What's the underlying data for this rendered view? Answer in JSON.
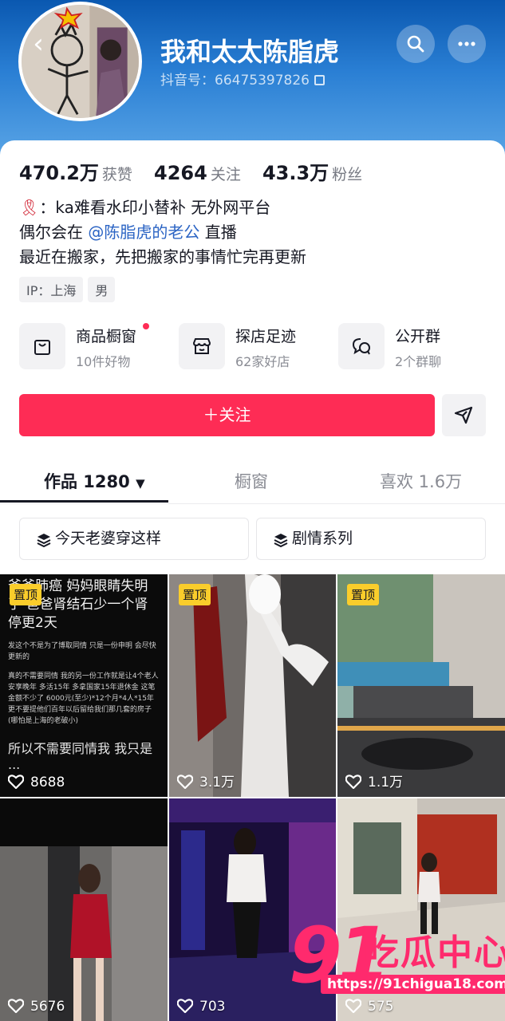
{
  "profile": {
    "nickname": "我和太太陈脂虎",
    "id_label": "抖音号：",
    "id_value": "66475397826"
  },
  "stats": [
    {
      "value": "470.2万",
      "label": "获赞"
    },
    {
      "value": "4264",
      "label": "关注"
    },
    {
      "value": "43.3万",
      "label": "粉丝"
    }
  ],
  "bio": {
    "line1": "：ka难看水印小替补 无外网平台",
    "line2_prefix": "偶尔会在 ",
    "line2_mention": "@陈脂虎的老公",
    "line2_suffix": " 直播",
    "line3": "最近在搬家，先把搬家的事情忙完再更新"
  },
  "tags": [
    "IP：上海",
    "男"
  ],
  "features": [
    {
      "title": "商品橱窗",
      "subtitle": "10件好物",
      "icon": "shopping-bag-icon"
    },
    {
      "title": "探店足迹",
      "subtitle": "62家好店",
      "icon": "store-icon"
    },
    {
      "title": "公开群",
      "subtitle": "2个群聊",
      "icon": "chat-group-icon"
    }
  ],
  "actions": {
    "follow_label": "＋关注",
    "share_icon": "send-icon"
  },
  "tabs": {
    "works": "作品 1280",
    "window": "橱窗",
    "likes": "喜欢 1.6万"
  },
  "collections": [
    "今天老婆穿这样",
    "剧情系列"
  ],
  "videos": [
    {
      "pinned": "置顶",
      "likes": "8688"
    },
    {
      "pinned": "置顶",
      "likes": "3.1万"
    },
    {
      "pinned": "置顶",
      "likes": "1.1万"
    },
    {
      "likes": "5676"
    },
    {
      "likes": "703"
    },
    {
      "likes": "575"
    }
  ],
  "text_post": {
    "title": "爷爷肺癌 妈妈眼睛失明了 爸爸肾结石少一个肾 停更2天",
    "note1": "发这个不是为了博取同情 只是一份申明 会尽快更新的",
    "note2": "真的不需要同情 我的另一份工作就是让4个老人安享晚年 多活15年 多拿国家15年退休金 这笔金额不少了 6000元(至少)*12个月*4人*15年 更不要提他们百年以后留给我们那几套的房子(哪怕是上海的老破小)",
    "note3": "所以不需要同情我 我只是 ..."
  },
  "watermark": {
    "number": "91",
    "name": "吃瓜中心",
    "url": "https://91chigua18.com"
  },
  "colors": {
    "accent": "#fe2c55",
    "pin": "#facd2b",
    "header_top": "#0a58b0",
    "mention": "#2b64c4"
  }
}
